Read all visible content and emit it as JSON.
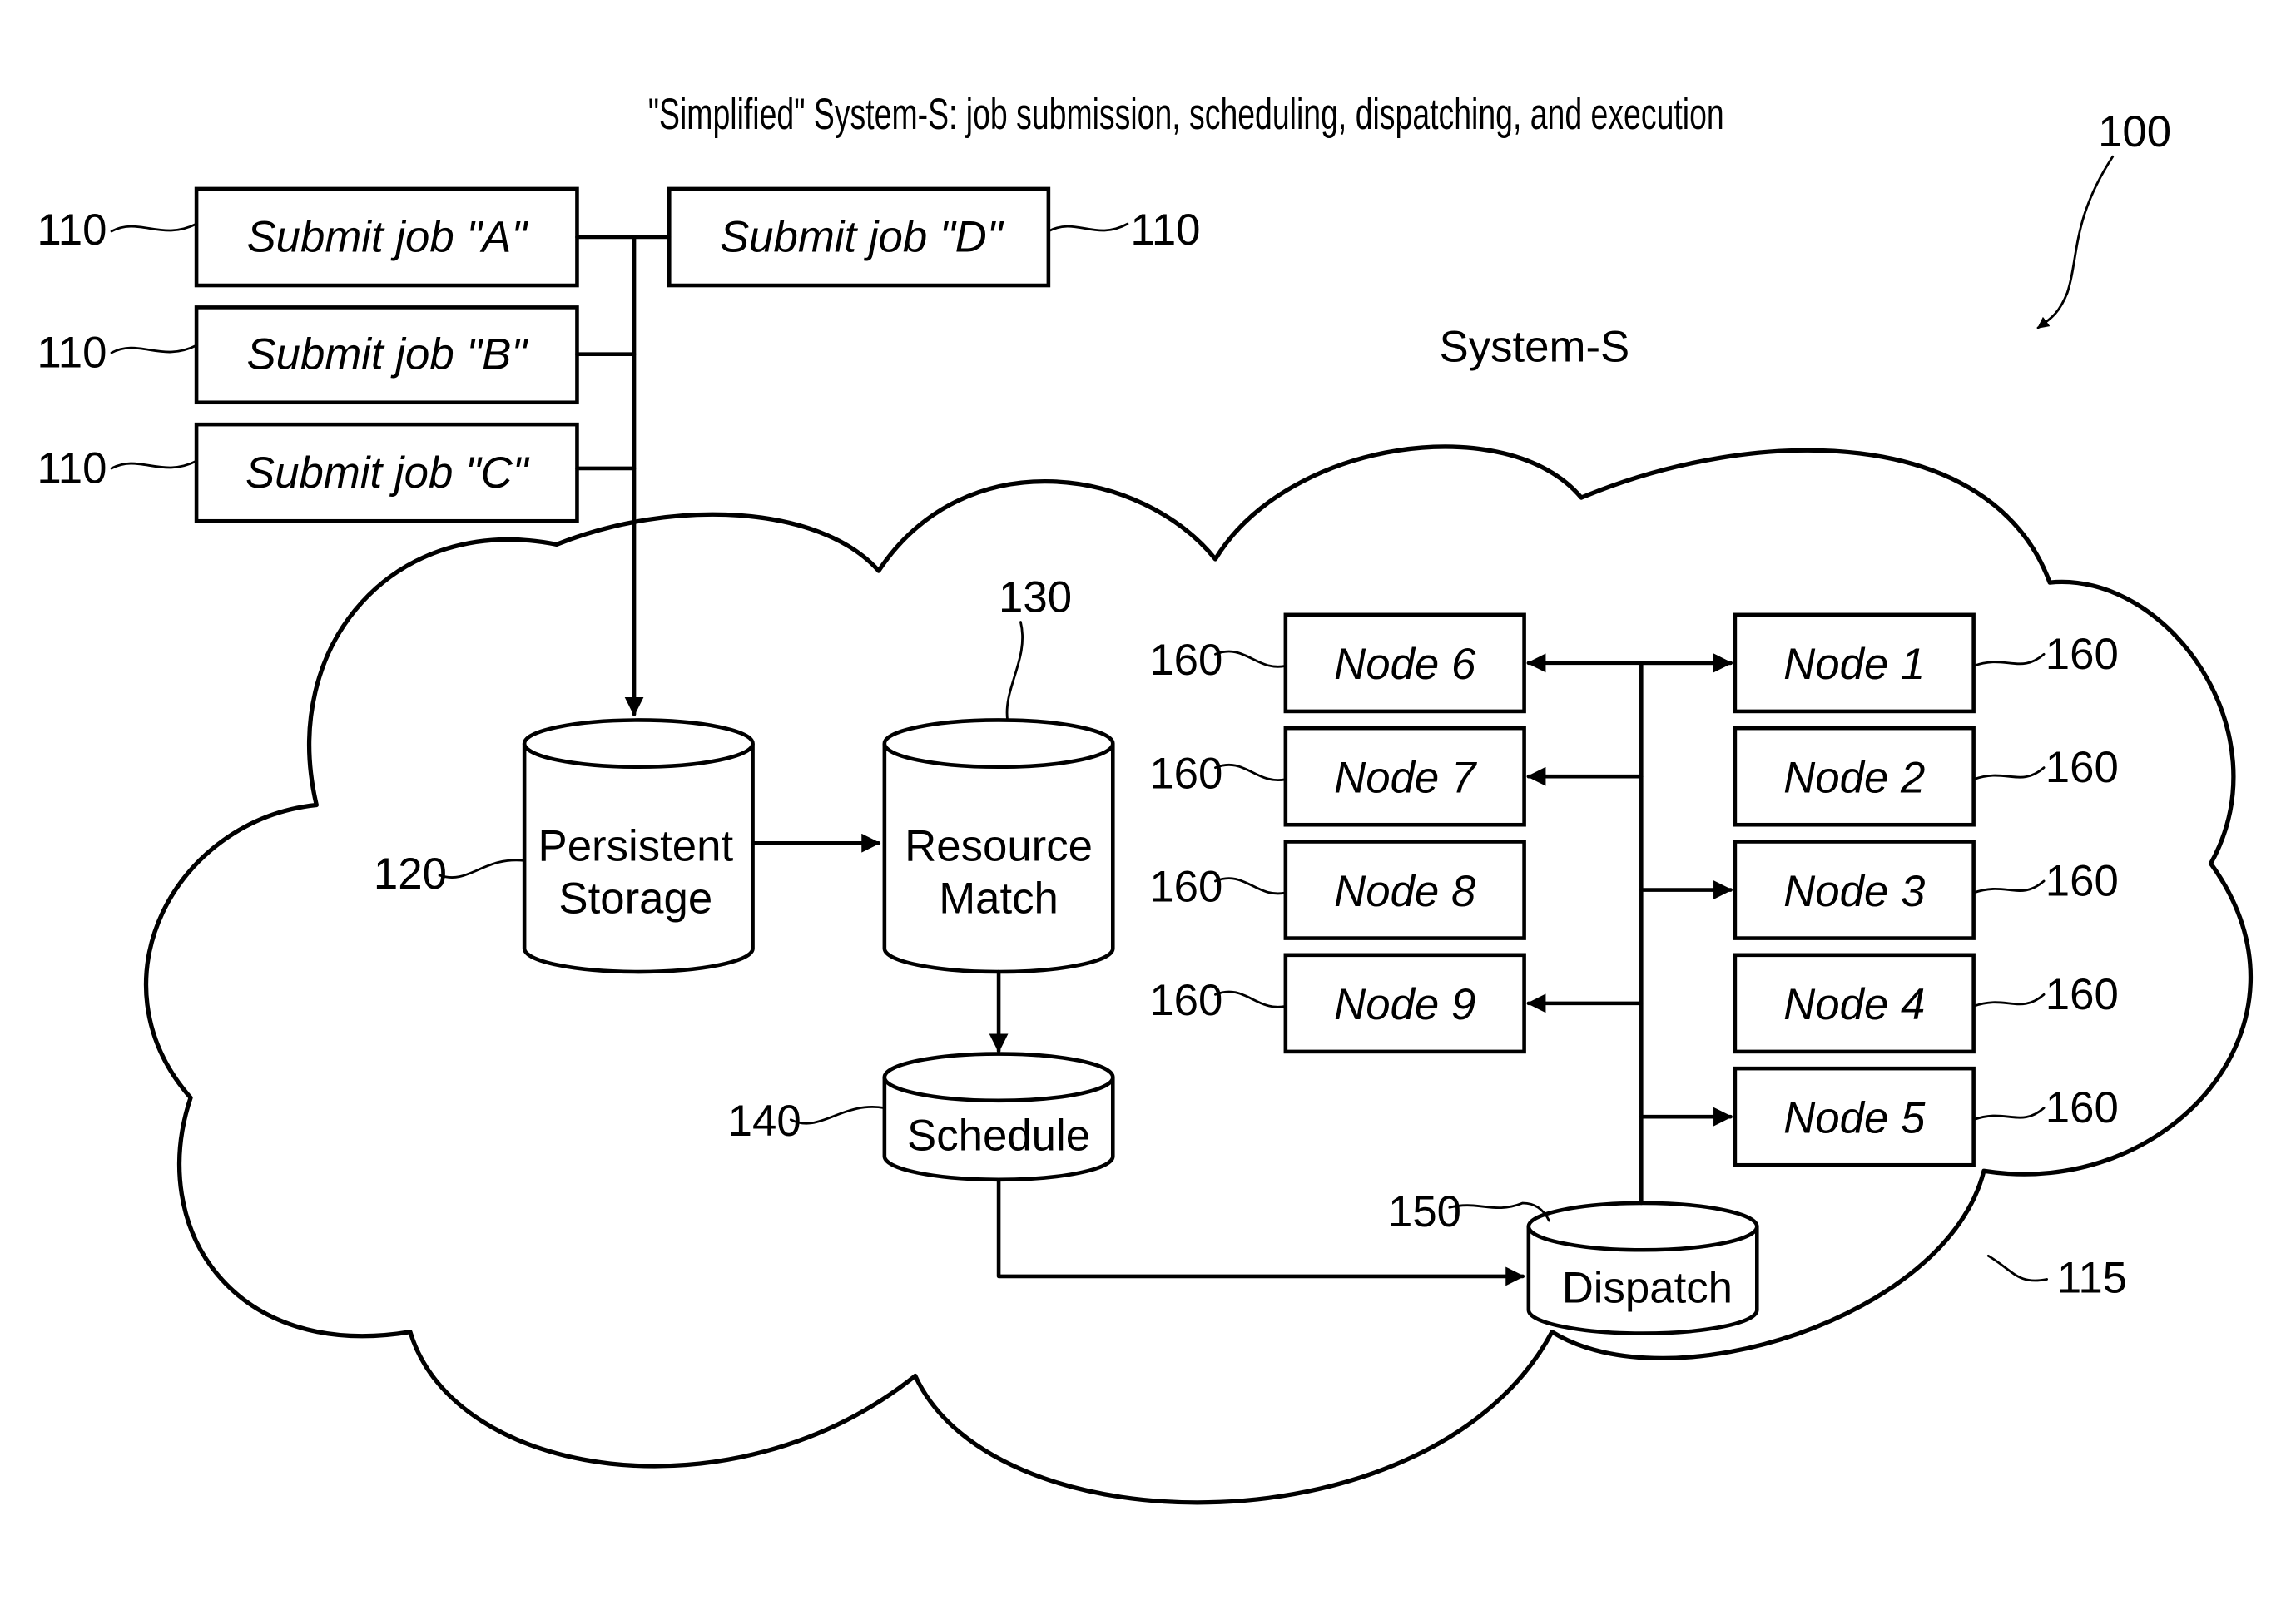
{
  "title": "\"Simplified\" System-S: job submission, scheduling, dispatching, and execution",
  "system_label": "System-S",
  "refs": {
    "figure": "100",
    "cloud": "115",
    "submit": "110",
    "persistent_storage": "120",
    "resource_match": "130",
    "schedule": "140",
    "dispatch": "150",
    "node": "160"
  },
  "submit_jobs": [
    {
      "label": "Submit job \"A\""
    },
    {
      "label": "Submit job \"B\""
    },
    {
      "label": "Submit job \"C\""
    },
    {
      "label": "Submit job \"D\""
    }
  ],
  "stores": {
    "persistent_storage": [
      "Persistent",
      "Storage"
    ],
    "resource_match": [
      "Resource",
      "Match"
    ],
    "schedule": "Schedule",
    "dispatch": "Dispatch"
  },
  "nodes_left": [
    {
      "label": "Node 6",
      "arrow": "both"
    },
    {
      "label": "Node 7",
      "arrow": "in"
    },
    {
      "label": "Node 8",
      "arrow": "none"
    },
    {
      "label": "Node 9",
      "arrow": "in"
    }
  ],
  "nodes_right": [
    {
      "label": "Node 1",
      "arrow": "in"
    },
    {
      "label": "Node 2",
      "arrow": "none"
    },
    {
      "label": "Node 3",
      "arrow": "in"
    },
    {
      "label": "Node 4",
      "arrow": "none"
    },
    {
      "label": "Node 5",
      "arrow": "in"
    }
  ]
}
